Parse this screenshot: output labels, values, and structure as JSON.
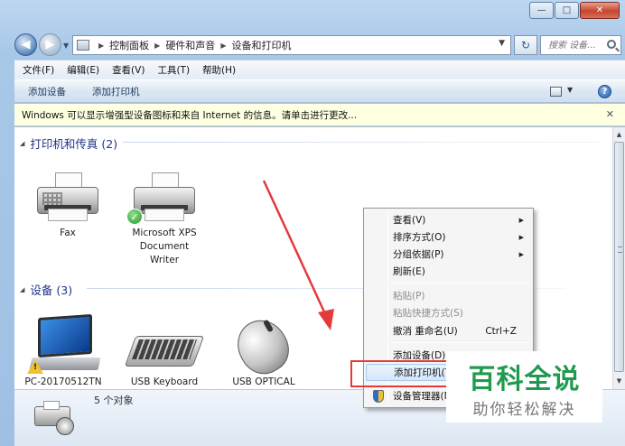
{
  "window": {
    "minimize": "—",
    "maximize": "□",
    "close": "✕"
  },
  "address": {
    "crumbs": [
      "控制面板",
      "硬件和声音",
      "设备和打印机"
    ],
    "search_placeholder": "搜索 设备..."
  },
  "menubar": {
    "items": [
      "文件(F)",
      "编辑(E)",
      "查看(V)",
      "工具(T)",
      "帮助(H)"
    ]
  },
  "commandbar": {
    "add_device": "添加设备",
    "add_printer": "添加打印机"
  },
  "infobar": {
    "text": "Windows 可以显示增强型设备图标和来自 Internet 的信息。请单击进行更改..."
  },
  "groups": {
    "printers": {
      "title": "打印机和传真 (2)",
      "items": [
        {
          "label": "Fax"
        },
        {
          "label_lines": [
            "Microsoft XPS",
            "Document",
            "Writer"
          ]
        }
      ]
    },
    "devices": {
      "title": "设备 (3)",
      "items": [
        {
          "label": "PC-20170512TN"
        },
        {
          "label": "USB Keyboard"
        },
        {
          "label": "USB OPTICAL"
        }
      ]
    }
  },
  "details": {
    "count": "5 个对象"
  },
  "context_menu": {
    "items": [
      {
        "label": "查看(V)",
        "submenu": true
      },
      {
        "label": "排序方式(O)",
        "submenu": true
      },
      {
        "label": "分组依据(P)",
        "submenu": true
      },
      {
        "label": "刷新(E)"
      },
      {
        "label": "粘贴(P)",
        "disabled": true
      },
      {
        "label": "粘贴快捷方式(S)",
        "disabled": true
      },
      {
        "label": "撤消 重命名(U)",
        "shortcut": "Ctrl+Z"
      },
      {
        "label": "添加设备(D)"
      },
      {
        "label": "添加打印机(T)"
      },
      {
        "label": "设备管理器(M)"
      }
    ]
  },
  "watermark": {
    "title": "百科全说",
    "subtitle": "助你轻松解决"
  },
  "colors": {
    "highlight_box": "#e33b3b",
    "arrow": "#e33b3b",
    "watermark_green": "#1f9a4e"
  }
}
